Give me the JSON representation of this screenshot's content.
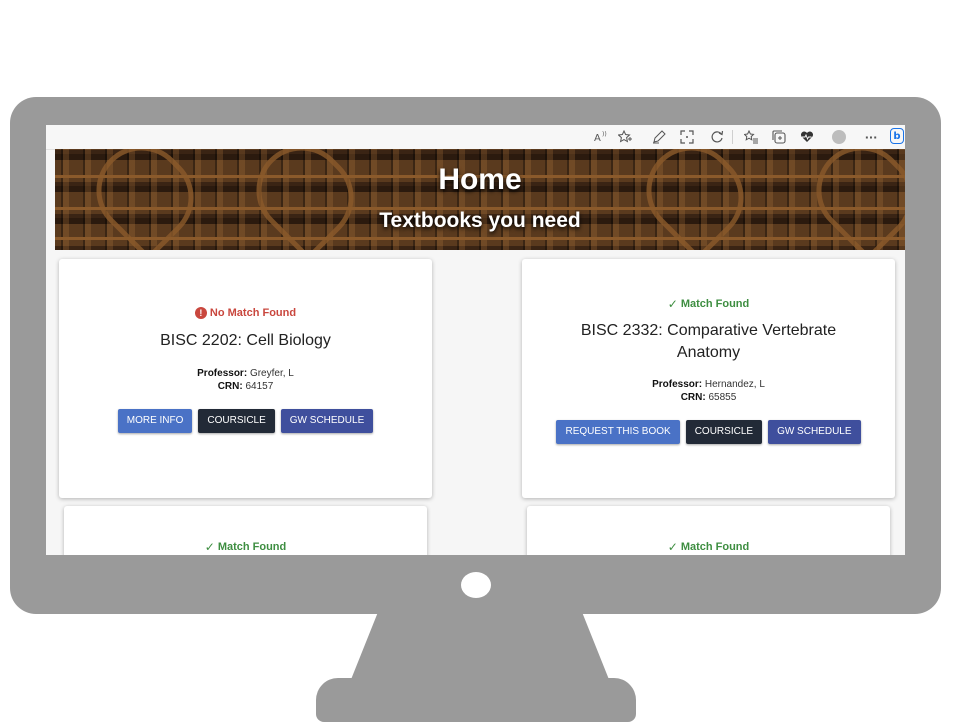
{
  "browser": {
    "toolbar_icons": [
      "read-aloud-icon",
      "favorite-add-icon",
      "pen-icon",
      "screenshot-icon",
      "refresh-icon",
      "favorites-icon",
      "collections-icon",
      "heart-icon",
      "profile-icon",
      "more-icon",
      "bing-icon"
    ],
    "more_label": "···",
    "bing_label": "b"
  },
  "hero": {
    "title": "Home",
    "subtitle": "Textbooks you need"
  },
  "cards": [
    {
      "status": "No Match Found",
      "status_type": "bad",
      "course": "BISC 2202: Cell Biology",
      "professor_label": "Professor:",
      "professor": "Greyfer, L",
      "crn_label": "CRN:",
      "crn": "64157",
      "buttons": [
        "MORE INFO",
        "COURSICLE",
        "GW SCHEDULE"
      ]
    },
    {
      "status": "Match Found",
      "status_type": "good",
      "course": "BISC 2332: Comparative Vertebrate Anatomy",
      "professor_label": "Professor:",
      "professor": "Hernandez, L",
      "crn_label": "CRN:",
      "crn": "65855",
      "buttons": [
        "REQUEST THIS BOOK",
        "COURSICLE",
        "GW SCHEDULE"
      ]
    },
    {
      "status": "Match Found",
      "status_type": "good"
    },
    {
      "status": "Match Found",
      "status_type": "good"
    }
  ],
  "icons": {
    "bad": "!",
    "good": "✓"
  },
  "colors": {
    "monitor": "#9a9a9a",
    "bad": "#c9473e",
    "good": "#3e8e41",
    "button_blue": "#4a72c6",
    "button_dark": "#222a37",
    "button_indigo": "#3f4f9d"
  }
}
